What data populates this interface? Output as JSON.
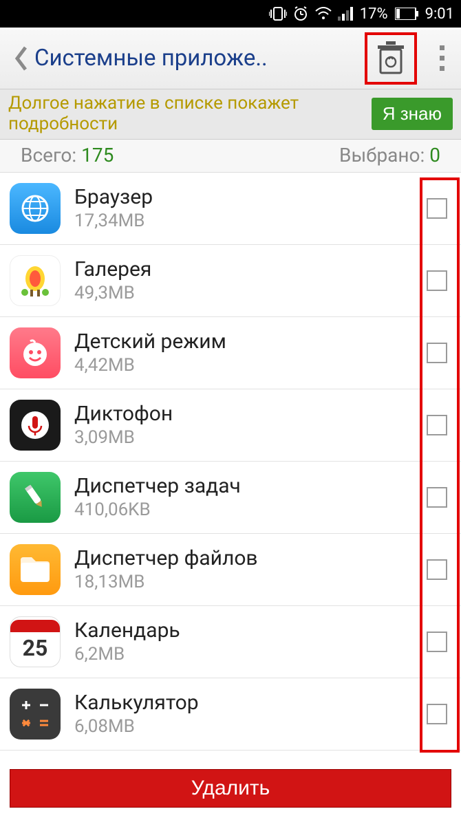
{
  "status": {
    "battery_pct": "17%",
    "time": "9:01"
  },
  "header": {
    "title": "Системные приложе.."
  },
  "hint": {
    "text": "Долгое нажатие в списке покажет подробности",
    "button": "Я знаю"
  },
  "summary": {
    "total_label": "Всего:",
    "total_value": "175",
    "selected_label": "Выбрано:",
    "selected_value": "0"
  },
  "apps": [
    {
      "name": "Браузер",
      "size": "17,34MB",
      "icon": "browser"
    },
    {
      "name": "Галерея",
      "size": "49,3MB",
      "icon": "gallery"
    },
    {
      "name": "Детский режим",
      "size": "4,42MB",
      "icon": "kids"
    },
    {
      "name": "Диктофон",
      "size": "3,09MB",
      "icon": "recorder"
    },
    {
      "name": "Диспетчер задач",
      "size": "410,06KB",
      "icon": "task"
    },
    {
      "name": "Диспетчер файлов",
      "size": "18,13MB",
      "icon": "files"
    },
    {
      "name": "Календарь",
      "size": "6,2MB",
      "icon": "calendar"
    },
    {
      "name": "Калькулятор",
      "size": "6,08MB",
      "icon": "calc"
    }
  ],
  "calendar_day": "25",
  "delete_label": "Удалить"
}
